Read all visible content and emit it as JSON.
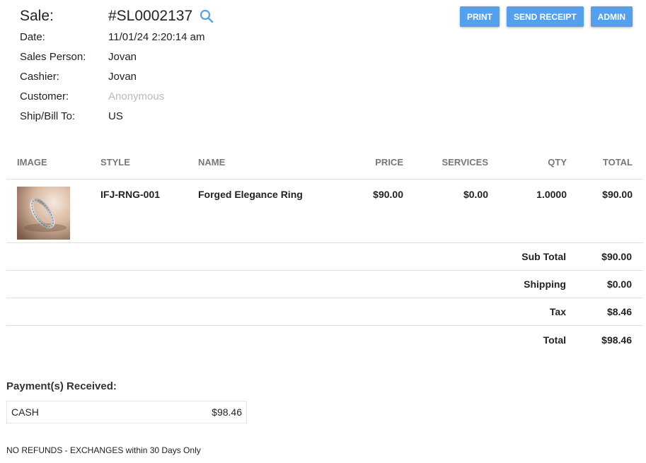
{
  "sale": {
    "label": "Sale:",
    "number": "#SL0002137"
  },
  "info": [
    {
      "label": "Date:",
      "value": "11/01/24 2:20:14 am",
      "muted": false
    },
    {
      "label": "Sales Person:",
      "value": "Jovan",
      "muted": false
    },
    {
      "label": "Cashier:",
      "value": "Jovan",
      "muted": false
    },
    {
      "label": "Customer:",
      "value": "Anonymous",
      "muted": true
    },
    {
      "label": "Ship/Bill To:",
      "value": "US",
      "muted": false
    }
  ],
  "actions": {
    "print": "PRINT",
    "send_receipt": "SEND RECEIPT",
    "admin": "ADMIN"
  },
  "table": {
    "headers": {
      "image": "IMAGE",
      "style": "STYLE",
      "name": "NAME",
      "price": "PRICE",
      "services": "SERVICES",
      "qty": "QTY",
      "total": "TOTAL"
    },
    "rows": [
      {
        "image_icon": "ring-photo",
        "style": "IFJ-RNG-001",
        "name": "Forged Elegance Ring",
        "price": "$90.00",
        "services": "$0.00",
        "qty": "1.0000",
        "total": "$90.00"
      }
    ]
  },
  "summary": {
    "subtotal_label": "Sub Total",
    "subtotal_value": "$90.00",
    "shipping_label": "Shipping",
    "shipping_value": "$0.00",
    "tax_label": "Tax",
    "tax_value": "$8.46",
    "total_label": "Total",
    "total_value": "$98.46"
  },
  "payments": {
    "title": "Payment(s) Received:",
    "items": [
      {
        "method": "CASH",
        "amount": "$98.46"
      }
    ]
  },
  "policy": "NO REFUNDS - EXCHANGES within 30 Days Only",
  "colors": {
    "accent": "#55a0ee",
    "muted_text": "#bbbbbb"
  }
}
